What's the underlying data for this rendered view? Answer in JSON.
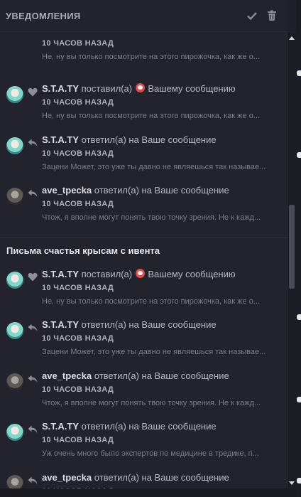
{
  "header": {
    "title": "УВЕДОМЛЕНИЯ",
    "mark_read_icon": "check-icon",
    "delete_icon": "trash-icon"
  },
  "top_item": {
    "time": "10 ЧАСОВ НАЗАД",
    "preview": "Не, ну вы только посмотрите на этого пирожочка, как же о..."
  },
  "items": [
    {
      "avatar": "teal",
      "type": "like",
      "user": "S.T.A.TY",
      "action": "поставил(а)",
      "emoji": true,
      "target": "Вашему сообщению",
      "time": "10 ЧАСОВ НАЗАД",
      "preview": "Не, ну вы только посмотрите на этого пирожочка, как же о..."
    },
    {
      "avatar": "teal",
      "type": "reply",
      "user": "S.T.A.TY",
      "action": "ответил(а) на Ваше сообщение",
      "emoji": false,
      "target": "",
      "time": "10 ЧАСОВ НАЗАД",
      "preview": "Зацени Может, это уже ты давно не являешься так называе..."
    },
    {
      "avatar": "gray",
      "type": "reply",
      "user": "ave_tpecka",
      "action": "ответил(а) на Ваше сообщение",
      "emoji": false,
      "target": "",
      "time": "10 ЧАСОВ НАЗАД",
      "preview": "Чтож, я вполне могут понять твою точку зрения. Не к кажд..."
    }
  ],
  "group": {
    "title": "Письма счастья крысам с ивента",
    "items": [
      {
        "avatar": "teal",
        "type": "like",
        "user": "S.T.A.TY",
        "action": "поставил(а)",
        "emoji": true,
        "target": "Вашему сообщению",
        "time": "10 ЧАСОВ НАЗАД",
        "preview": "Не, ну вы только посмотрите на этого пирожочка, как же о..."
      },
      {
        "avatar": "teal",
        "type": "reply",
        "user": "S.T.A.TY",
        "action": "ответил(а) на Ваше сообщение",
        "emoji": false,
        "target": "",
        "time": "10 ЧАСОВ НАЗАД",
        "preview": "Зацени Может, это уже ты давно не являешься так называе..."
      },
      {
        "avatar": "gray",
        "type": "reply",
        "user": "ave_tpecka",
        "action": "ответил(а) на Ваше сообщение",
        "emoji": false,
        "target": "",
        "time": "10 ЧАСОВ НАЗАД",
        "preview": "Чтож, я вполне могут понять твою точку зрения. Не к кажд..."
      },
      {
        "avatar": "teal",
        "type": "reply",
        "user": "S.T.A.TY",
        "action": "ответил(а) на Ваше сообщение",
        "emoji": false,
        "target": "",
        "time": "10 ЧАСОВ НАЗАД",
        "preview": "Уж очень много было экспертов по медицине в тредике, п..."
      },
      {
        "avatar": "gray",
        "type": "reply",
        "user": "ave_tpecka",
        "action": "ответил(а) на Ваше сообщение",
        "emoji": false,
        "target": "",
        "time": "10 ЧАСОВ НАЗАД",
        "preview": ""
      }
    ]
  },
  "colors": {
    "background": "#22232c",
    "text": "#c9cad3",
    "muted": "#7c7d89",
    "emoji": "#e94848"
  }
}
